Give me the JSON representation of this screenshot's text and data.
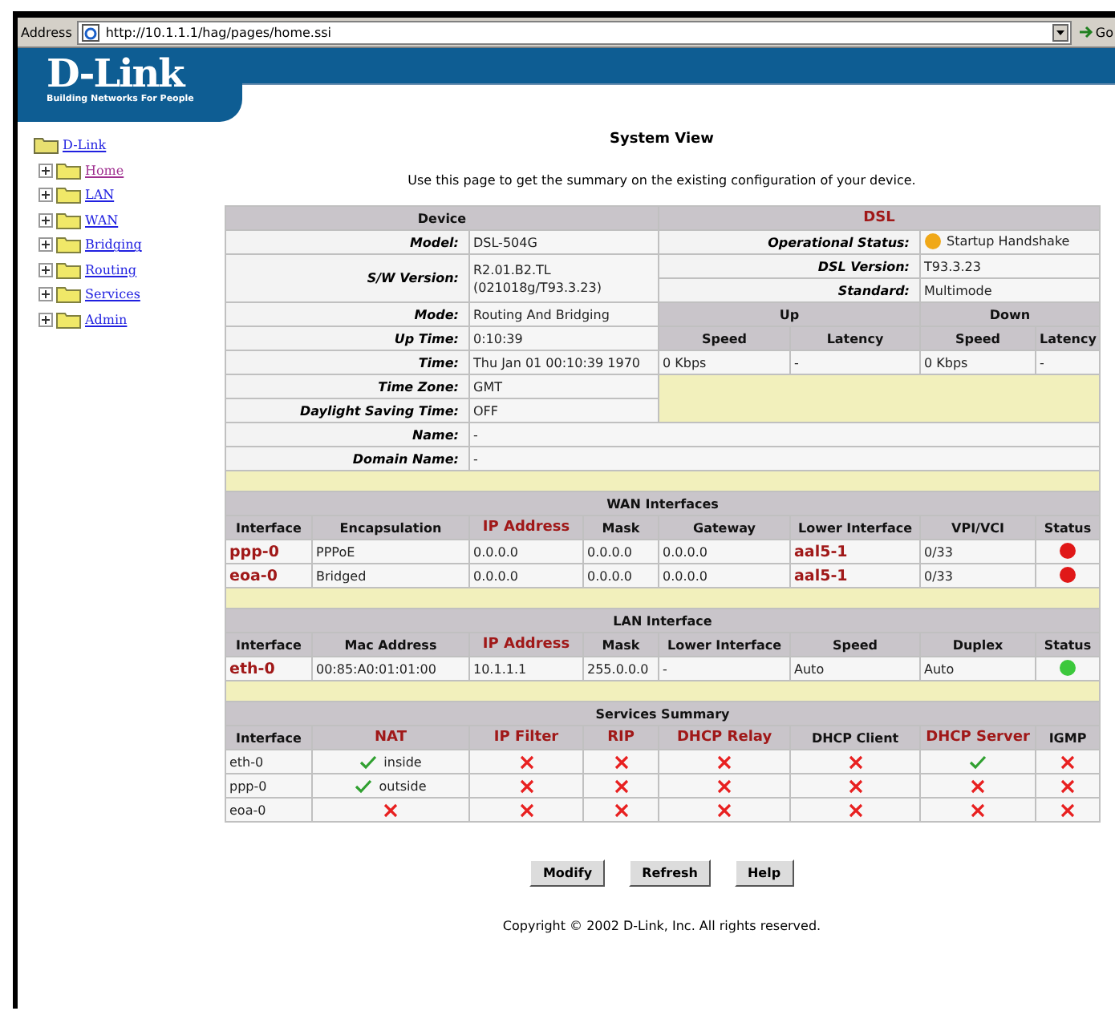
{
  "address_bar": {
    "label": "Address",
    "url": "http://10.1.1.1/hag/pages/home.ssi",
    "go": "Go"
  },
  "logo": {
    "name": "D-Link",
    "tagline": "Building Networks For People"
  },
  "tree": {
    "root": "D-Link",
    "children": [
      {
        "label": "Home",
        "visited": true,
        "expanded": false
      },
      {
        "label": "LAN",
        "visited": false,
        "expanded": false
      },
      {
        "label": "WAN",
        "visited": false,
        "expanded": false
      },
      {
        "label": "Bridging",
        "visited": false,
        "expanded": false
      },
      {
        "label": "Routing",
        "visited": false,
        "expanded": false
      },
      {
        "label": "Services",
        "visited": false,
        "expanded": false
      },
      {
        "label": "Admin",
        "visited": false,
        "expanded": false
      }
    ]
  },
  "title": "System View",
  "description": "Use this page to get the summary on the existing configuration of your device.",
  "device": {
    "heading": "Device",
    "model": {
      "label": "Model:",
      "value": "DSL-504G"
    },
    "sw_version": {
      "label": "S/W Version:",
      "value": "R2.01.B2.TL\n(021018g/T93.3.23)"
    },
    "mode": {
      "label": "Mode:",
      "value": "Routing And Bridging"
    },
    "up_time": {
      "label": "Up Time:",
      "value": "0:10:39"
    },
    "time": {
      "label": "Time:",
      "value": "Thu Jan 01 00:10:39 1970"
    },
    "time_zone": {
      "label": "Time Zone:",
      "value": "GMT"
    },
    "daylight_saving": {
      "label": "Daylight Saving Time:",
      "value": "OFF"
    },
    "name": {
      "label": "Name:",
      "value": "-"
    },
    "domain_name": {
      "label": "Domain Name:",
      "value": "-"
    }
  },
  "dsl": {
    "heading": "DSL",
    "operational_status": {
      "label": "Operational Status:",
      "value": "Startup Handshake",
      "color": "#f0a818"
    },
    "dsl_version": {
      "label": "DSL Version:",
      "value": "T93.3.23"
    },
    "standard": {
      "label": "Standard:",
      "value": "Multimode"
    },
    "up": {
      "heading": "Up",
      "speed_label": "Speed",
      "latency_label": "Latency",
      "speed": "0 Kbps",
      "latency": "-"
    },
    "down": {
      "heading": "Down",
      "speed_label": "Speed",
      "latency_label": "Latency",
      "speed": "0 Kbps",
      "latency": "-"
    }
  },
  "wan": {
    "heading": "WAN Interfaces",
    "columns": [
      {
        "label": "Interface",
        "highlighted": false
      },
      {
        "label": "Encapsulation",
        "highlighted": false
      },
      {
        "label": "IP Address",
        "highlighted": true
      },
      {
        "label": "Mask",
        "highlighted": false
      },
      {
        "label": "Gateway",
        "highlighted": false
      },
      {
        "label": "Lower Interface",
        "highlighted": false
      },
      {
        "label": "VPI/VCI",
        "highlighted": false
      },
      {
        "label": "Status",
        "highlighted": false
      }
    ],
    "rows": [
      {
        "interface": "ppp-0",
        "encapsulation": "PPPoE",
        "ip_address": "0.0.0.0",
        "mask": "0.0.0.0",
        "gateway": "0.0.0.0",
        "lower_interface": "aal5-1",
        "vpi_vci": "0/33",
        "color": "#e01818"
      },
      {
        "interface": "eoa-0",
        "encapsulation": "Bridged",
        "ip_address": "0.0.0.0",
        "mask": "0.0.0.0",
        "gateway": "0.0.0.0",
        "lower_interface": "aal5-1",
        "vpi_vci": "0/33",
        "color": "#e01818"
      }
    ]
  },
  "lan": {
    "heading": "LAN Interface",
    "columns": [
      {
        "label": "Interface",
        "highlighted": false
      },
      {
        "label": "Mac Address",
        "highlighted": false
      },
      {
        "label": "IP Address",
        "highlighted": true
      },
      {
        "label": "Mask",
        "highlighted": false
      },
      {
        "label": "Lower Interface",
        "highlighted": false
      },
      {
        "label": "Speed",
        "highlighted": false
      },
      {
        "label": "Duplex",
        "highlighted": false
      },
      {
        "label": "Status",
        "highlighted": false
      }
    ],
    "rows": [
      {
        "interface": "eth-0",
        "mac_address": "00:85:A0:01:01:00",
        "ip_address": "10.1.1.1",
        "mask": "255.0.0.0",
        "lower_interface": "-",
        "speed": "Auto",
        "duplex": "Auto",
        "color": "#3cc83c"
      }
    ]
  },
  "services": {
    "heading": "Services Summary",
    "columns": [
      {
        "label": "Interface",
        "highlighted": false
      },
      {
        "label": "NAT",
        "highlighted": true
      },
      {
        "label": "IP Filter",
        "highlighted": true
      },
      {
        "label": "RIP",
        "highlighted": true
      },
      {
        "label": "DHCP Relay",
        "highlighted": true
      },
      {
        "label": "DHCP Client",
        "highlighted": false
      },
      {
        "label": "DHCP Server",
        "highlighted": true
      },
      {
        "label": "IGMP",
        "highlighted": false
      }
    ],
    "rows": [
      {
        "interface": "eth-0",
        "cells": [
          {
            "enabled": true,
            "note": "inside"
          },
          {
            "enabled": false
          },
          {
            "enabled": false
          },
          {
            "enabled": false
          },
          {
            "enabled": false
          },
          {
            "enabled": true
          },
          {
            "enabled": false
          }
        ]
      },
      {
        "interface": "ppp-0",
        "cells": [
          {
            "enabled": true,
            "note": "outside"
          },
          {
            "enabled": false
          },
          {
            "enabled": false
          },
          {
            "enabled": false
          },
          {
            "enabled": false
          },
          {
            "enabled": false
          },
          {
            "enabled": false
          }
        ]
      },
      {
        "interface": "eoa-0",
        "cells": [
          {
            "enabled": false
          },
          {
            "enabled": false
          },
          {
            "enabled": false
          },
          {
            "enabled": false
          },
          {
            "enabled": false
          },
          {
            "enabled": false
          },
          {
            "enabled": false
          }
        ]
      }
    ]
  },
  "buttons": [
    "Modify",
    "Refresh",
    "Help"
  ],
  "copyright": "Copyright © 2002 D-Link, Inc. All rights reserved."
}
